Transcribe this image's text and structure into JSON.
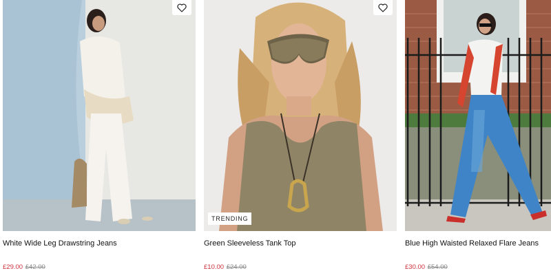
{
  "products": [
    {
      "title": "White Wide Leg Drawstring Jeans",
      "price_now": "£29.00",
      "price_was": "£42.00",
      "badge": "",
      "has_wishlist": true
    },
    {
      "title": "Green Sleeveless Tank Top",
      "price_now": "£10.00",
      "price_was": "£24.00",
      "badge": "TRENDING",
      "has_wishlist": true
    },
    {
      "title": "Blue High Waisted Relaxed Flare Jeans",
      "price_now": "£30.00",
      "price_was": "£54.00",
      "badge": "",
      "has_wishlist": false
    }
  ],
  "colors": {
    "sale_price": "#d0323c",
    "was_price": "#8a8a8a"
  }
}
